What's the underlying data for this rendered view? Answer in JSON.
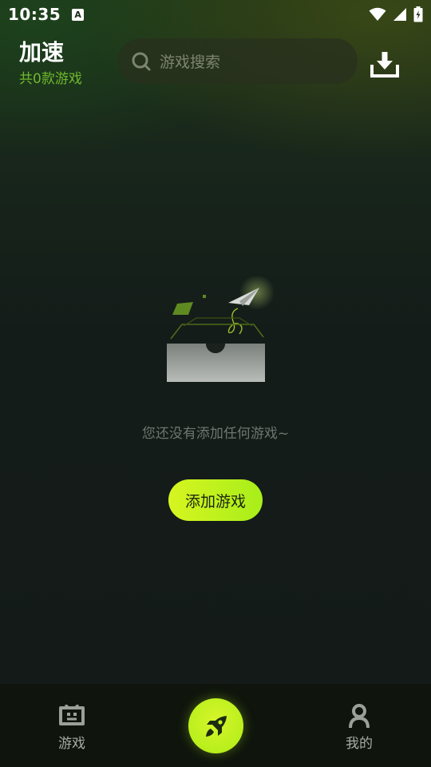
{
  "status_bar": {
    "time": "10:35",
    "notification_icon": "a-icon",
    "icons": [
      "wifi-icon",
      "signal-icon",
      "battery-charging-icon"
    ]
  },
  "header": {
    "title": "加速",
    "game_count": "共0款游戏",
    "search": {
      "placeholder": "游戏搜索",
      "icon": "search-icon"
    },
    "download_icon": "download-icon"
  },
  "empty_state": {
    "message": "您还没有添加任何游戏~",
    "add_button_label": "添加游戏",
    "illustration": "empty-box-paper-plane-illustration"
  },
  "bottom_nav": {
    "items": [
      {
        "label": "游戏",
        "icon": "gamepad-icon"
      },
      {
        "label": "",
        "icon": "rocket-icon"
      },
      {
        "label": "我的",
        "icon": "user-icon"
      }
    ]
  },
  "colors": {
    "accent": "#c4f222",
    "count_text": "#6fb82e",
    "background": "#131a18",
    "nav_background": "#0f150c"
  }
}
